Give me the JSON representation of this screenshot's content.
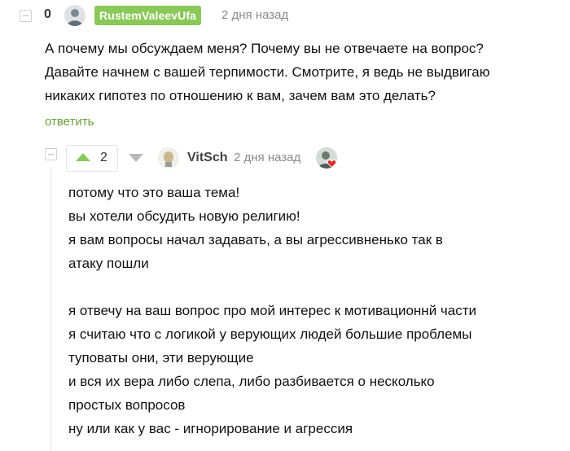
{
  "parent_comment": {
    "rating": "0",
    "author": "RustemValeevUfa",
    "time": "2 дня назад",
    "lines": [
      "А почему мы обсуждаем меня? Почему вы не отвечаете на вопрос?",
      "Давайте начнем с вашей терпимости. Смотрите, я ведь не выдвигаю",
      "никаких гипотез по отношению к вам, зачем вам это делать?"
    ],
    "reply_label": "ответить"
  },
  "reply_comment": {
    "rating": "2",
    "author": "VitSch",
    "time": "2 дня назад",
    "lines": [
      "потому что это ваша тема!",
      "вы хотели обсудить новую религию!",
      "я вам вопросы начал задавать, а вы агрессивненько так в",
      "атаку пошли",
      "",
      "я отвечу на ваш вопрос про мой интерес к мотивационнй части",
      "я считаю что с логикой у верующих людей большие проблемы",
      "туповаты они, эти верующие",
      "и вся их вера либо слепа, либо разбивается о несколько",
      "простых вопросов",
      "ну или как у вас - игнорирование и агрессия"
    ]
  },
  "colors": {
    "accent_green": "#8ac858",
    "link_green": "#6a9e3a",
    "muted": "#8a8a8a"
  }
}
